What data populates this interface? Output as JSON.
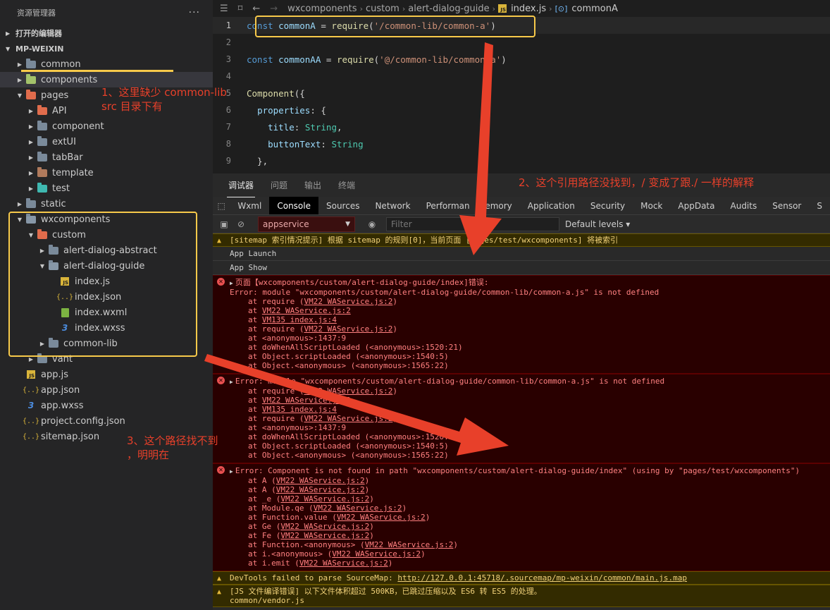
{
  "sidebar": {
    "title": "资源管理器",
    "more": "···",
    "open_editors": "打开的编辑器",
    "project": "MP-WEIXIN",
    "tree": [
      {
        "label": "common",
        "depth": 1,
        "twist": "closed",
        "icon": "folder"
      },
      {
        "label": "components",
        "depth": 1,
        "twist": "closed",
        "icon": "folder-green",
        "selected": true
      },
      {
        "label": "pages",
        "depth": 1,
        "twist": "open",
        "icon": "folder-red"
      },
      {
        "label": "API",
        "depth": 2,
        "twist": "closed",
        "icon": "folder-red"
      },
      {
        "label": "component",
        "depth": 2,
        "twist": "closed",
        "icon": "folder"
      },
      {
        "label": "extUI",
        "depth": 2,
        "twist": "closed",
        "icon": "folder"
      },
      {
        "label": "tabBar",
        "depth": 2,
        "twist": "closed",
        "icon": "folder"
      },
      {
        "label": "template",
        "depth": 2,
        "twist": "closed",
        "icon": "folder-brown"
      },
      {
        "label": "test",
        "depth": 2,
        "twist": "closed",
        "icon": "folder-teal"
      },
      {
        "label": "static",
        "depth": 1,
        "twist": "closed",
        "icon": "folder"
      },
      {
        "label": "wxcomponents",
        "depth": 1,
        "twist": "open",
        "icon": "folder-open"
      },
      {
        "label": "custom",
        "depth": 2,
        "twist": "open",
        "icon": "folder-red"
      },
      {
        "label": "alert-dialog-abstract",
        "depth": 3,
        "twist": "closed",
        "icon": "folder"
      },
      {
        "label": "alert-dialog-guide",
        "depth": 3,
        "twist": "open",
        "icon": "folder-open"
      },
      {
        "label": "index.js",
        "depth": 4,
        "twist": "none",
        "icon": "js"
      },
      {
        "label": "index.json",
        "depth": 4,
        "twist": "none",
        "icon": "json"
      },
      {
        "label": "index.wxml",
        "depth": 4,
        "twist": "none",
        "icon": "wxml"
      },
      {
        "label": "index.wxss",
        "depth": 4,
        "twist": "none",
        "icon": "wxss"
      },
      {
        "label": "common-lib",
        "depth": 3,
        "twist": "closed",
        "icon": "folder"
      },
      {
        "label": "vant",
        "depth": 2,
        "twist": "closed",
        "icon": "folder"
      },
      {
        "label": "app.js",
        "depth": 1,
        "twist": "none",
        "icon": "js"
      },
      {
        "label": "app.json",
        "depth": 1,
        "twist": "none",
        "icon": "json"
      },
      {
        "label": "app.wxss",
        "depth": 1,
        "twist": "none",
        "icon": "wxss"
      },
      {
        "label": "project.config.json",
        "depth": 1,
        "twist": "none",
        "icon": "json"
      },
      {
        "label": "sitemap.json",
        "depth": 1,
        "twist": "none",
        "icon": "json"
      }
    ]
  },
  "editor": {
    "breadcrumb": [
      "wxcomponents",
      "custom",
      "alert-dialog-guide",
      "index.js",
      "commonA"
    ],
    "code": [
      {
        "n": "1",
        "parts": [
          [
            "kw",
            "const "
          ],
          [
            "var",
            "commonA"
          ],
          [
            "plain",
            " = "
          ],
          [
            "fn",
            "require"
          ],
          [
            "plain",
            "("
          ],
          [
            "str",
            "'/common-lib/common-a'"
          ],
          [
            "plain",
            ")"
          ]
        ]
      },
      {
        "n": "2",
        "parts": []
      },
      {
        "n": "3",
        "parts": [
          [
            "kw",
            "const "
          ],
          [
            "var",
            "commonAA"
          ],
          [
            "plain",
            " = "
          ],
          [
            "fn",
            "require"
          ],
          [
            "plain",
            "("
          ],
          [
            "str",
            "'@/common-lib/common-a'"
          ],
          [
            "plain",
            ")"
          ]
        ]
      },
      {
        "n": "4",
        "parts": []
      },
      {
        "n": "5",
        "parts": [
          [
            "fn",
            "Component"
          ],
          [
            "plain",
            "({"
          ]
        ]
      },
      {
        "n": "6",
        "parts": [
          [
            "plain",
            "  "
          ],
          [
            "prop",
            "properties"
          ],
          [
            "plain",
            ": {"
          ]
        ]
      },
      {
        "n": "7",
        "parts": [
          [
            "plain",
            "    "
          ],
          [
            "prop",
            "title"
          ],
          [
            "plain",
            ": "
          ],
          [
            "type",
            "String"
          ],
          [
            "plain",
            ","
          ]
        ]
      },
      {
        "n": "8",
        "parts": [
          [
            "plain",
            "    "
          ],
          [
            "prop",
            "buttonText"
          ],
          [
            "plain",
            ": "
          ],
          [
            "type",
            "String"
          ]
        ]
      },
      {
        "n": "9",
        "parts": [
          [
            "plain",
            "  },"
          ]
        ]
      }
    ]
  },
  "panel": {
    "tabs": [
      "调试器",
      "问题",
      "输出",
      "终端"
    ],
    "devtools_tabs": [
      "Wxml",
      "Console",
      "Sources",
      "Network",
      "Performance",
      "Memory",
      "Application",
      "Security",
      "Mock",
      "AppData",
      "Audits",
      "Sensor",
      "S"
    ],
    "context": "appservice",
    "filter_placeholder": "Filter",
    "levels": "Default levels ▾"
  },
  "console": {
    "warn1": "[sitemap 索引情况提示] 根据 sitemap 的规则[0]，当前页面 [pages/test/wxcomponents] 将被索引",
    "info1": "App Launch",
    "info2": "App Show",
    "err1_head": "页面【wxcomponents/custom/alert-dialog-guide/index]错误:",
    "err1_msg": "Error: module \"wxcomponents/custom/alert-dialog-guide/common-lib/common-a.js\" is not defined",
    "err1_stack": [
      [
        "at require (",
        "VM22 WAService.js:2",
        ")"
      ],
      [
        "at ",
        "VM22 WAService.js:2",
        ""
      ],
      [
        "at ",
        "VM135 index.js:4",
        ""
      ],
      [
        "at require (",
        "VM22 WAService.js:2",
        ")"
      ],
      [
        "at <anonymous>:1437:9",
        "",
        ""
      ],
      [
        "at doWhenAllScriptLoaded (<anonymous>:1520:21)",
        "",
        ""
      ],
      [
        "at Object.scriptLoaded (<anonymous>:1540:5)",
        "",
        ""
      ],
      [
        "at Object.<anonymous> (<anonymous>:1565:22)",
        "",
        ""
      ]
    ],
    "err2_msg": "Error: module \"wxcomponents/custom/alert-dialog-guide/common-lib/common-a.js\" is not defined",
    "err2_stack": [
      [
        "at require (",
        "VM22 WAService.js:2",
        ")"
      ],
      [
        "at ",
        "VM22 WAService.js:2",
        ""
      ],
      [
        "at ",
        "VM135 index.js:4",
        ""
      ],
      [
        "at require (",
        "VM22 WAService.js:2",
        ")"
      ],
      [
        "at <anonymous>:1437:9",
        "",
        ""
      ],
      [
        "at doWhenAllScriptLoaded (<anonymous>:1520:21)",
        "",
        ""
      ],
      [
        "at Object.scriptLoaded (<anonymous>:1540:5)",
        "",
        ""
      ],
      [
        "at Object.<anonymous> (<anonymous>:1565:22)",
        "",
        ""
      ]
    ],
    "err3_msg": "Error: Component is not found in path \"wxcomponents/custom/alert-dialog-guide/index\" (using by \"pages/test/wxcomponents\")",
    "err3_stack": [
      [
        "at A (",
        "VM22 WAService.js:2",
        ")"
      ],
      [
        "at A (",
        "VM22 WAService.js:2",
        ")"
      ],
      [
        "at _e (",
        "VM22 WAService.js:2",
        ")"
      ],
      [
        "at Module.qe (",
        "VM22 WAService.js:2",
        ")"
      ],
      [
        "at Function.value (",
        "VM22 WAService.js:2",
        ")"
      ],
      [
        "at Ge (",
        "VM22 WAService.js:2",
        ")"
      ],
      [
        "at Fe (",
        "VM22 WAService.js:2",
        ")"
      ],
      [
        "at Function.<anonymous> (",
        "VM22 WAService.js:2",
        ")"
      ],
      [
        "at i.<anonymous> (",
        "VM22 WAService.js:2",
        ")"
      ],
      [
        "at i.emit (",
        "VM22 WAService.js:2",
        ")"
      ]
    ],
    "warn2_text": "DevTools failed to parse SourceMap: ",
    "warn2_link": "http://127.0.0.1:45718/.sourcemap/mp-weixin/common/main.js.map",
    "warn3_line1": "[JS 文件编译错误] 以下文件体积超过 500KB，已跳过压缩以及 ES6 转 ES5 的处理。",
    "warn3_line2": "common/vendor.js",
    "prompt": ">"
  },
  "annotations": {
    "note1_line1": "1、这里缺少 common-lib",
    "note1_line2": "src 目录下有",
    "note2": "2、这个引用路径没找到，/ 变成了跟./ 一样的解释",
    "note3_line1": "3、这个路径找不到",
    "note3_line2": "，明明在",
    "annotation_color": "#e8402a",
    "highlight_color": "#f7c94a"
  }
}
